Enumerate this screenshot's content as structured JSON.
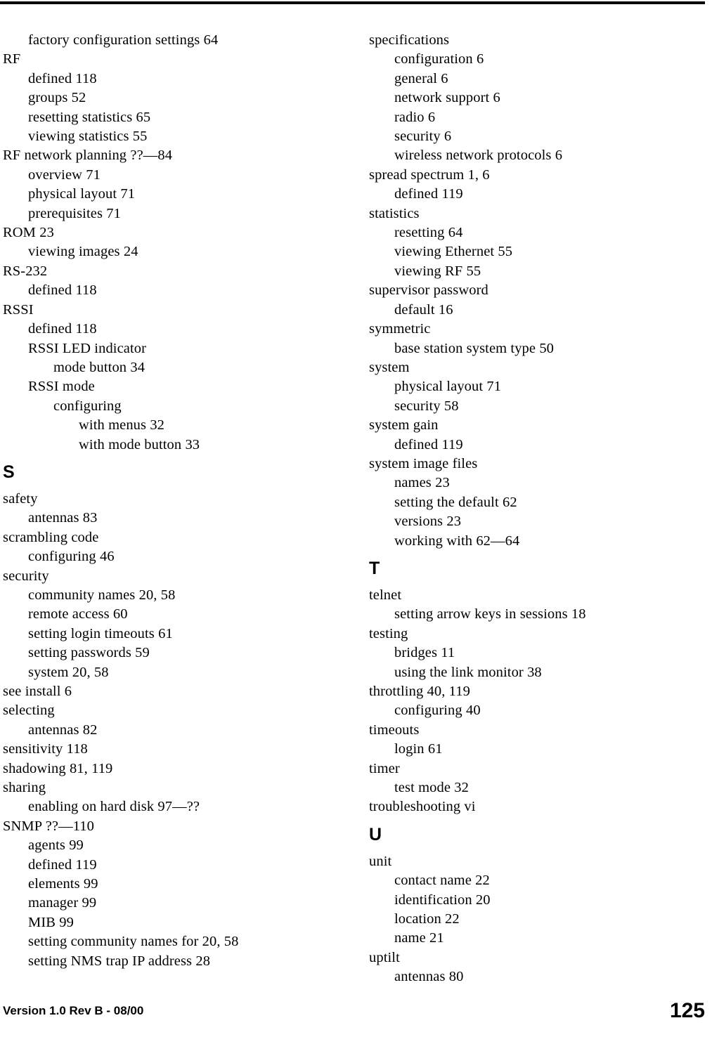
{
  "document": {
    "type": "index",
    "page_number": "125",
    "footer_version": "Version 1.0 Rev B - 08/00"
  },
  "columns": {
    "left": [
      {
        "kind": "entry",
        "level": 1,
        "text": "factory configuration settings 64"
      },
      {
        "kind": "entry",
        "level": 0,
        "text": "RF"
      },
      {
        "kind": "entry",
        "level": 1,
        "text": "defined 118"
      },
      {
        "kind": "entry",
        "level": 1,
        "text": "groups 52"
      },
      {
        "kind": "entry",
        "level": 1,
        "text": "resetting statistics 65"
      },
      {
        "kind": "entry",
        "level": 1,
        "text": "viewing statistics 55"
      },
      {
        "kind": "entry",
        "level": 0,
        "text": "RF network planning ??—84"
      },
      {
        "kind": "entry",
        "level": 1,
        "text": "overview 71"
      },
      {
        "kind": "entry",
        "level": 1,
        "text": "physical layout 71"
      },
      {
        "kind": "entry",
        "level": 1,
        "text": "prerequisites 71"
      },
      {
        "kind": "entry",
        "level": 0,
        "text": "ROM 23"
      },
      {
        "kind": "entry",
        "level": 1,
        "text": "viewing images 24"
      },
      {
        "kind": "entry",
        "level": 0,
        "text": "RS-232"
      },
      {
        "kind": "entry",
        "level": 1,
        "text": "defined 118"
      },
      {
        "kind": "entry",
        "level": 0,
        "text": "RSSI"
      },
      {
        "kind": "entry",
        "level": 1,
        "text": "defined 118"
      },
      {
        "kind": "entry",
        "level": 1,
        "text": "RSSI LED indicator"
      },
      {
        "kind": "entry",
        "level": 2,
        "text": "mode button 34"
      },
      {
        "kind": "entry",
        "level": 1,
        "text": "RSSI mode"
      },
      {
        "kind": "entry",
        "level": 2,
        "text": "configuring"
      },
      {
        "kind": "entry",
        "level": 3,
        "text": "with menus 32"
      },
      {
        "kind": "entry",
        "level": 3,
        "text": "with mode button 33"
      },
      {
        "kind": "heading",
        "level": 0,
        "text": "S"
      },
      {
        "kind": "entry",
        "level": 0,
        "text": "safety"
      },
      {
        "kind": "entry",
        "level": 1,
        "text": "antennas 83"
      },
      {
        "kind": "entry",
        "level": 0,
        "text": "scrambling code"
      },
      {
        "kind": "entry",
        "level": 1,
        "text": "configuring 46"
      },
      {
        "kind": "entry",
        "level": 0,
        "text": "security"
      },
      {
        "kind": "entry",
        "level": 1,
        "text": "community names 20, 58"
      },
      {
        "kind": "entry",
        "level": 1,
        "text": "remote access 60"
      },
      {
        "kind": "entry",
        "level": 1,
        "text": "setting login timeouts 61"
      },
      {
        "kind": "entry",
        "level": 1,
        "text": "setting passwords 59"
      },
      {
        "kind": "entry",
        "level": 1,
        "text": "system 20, 58"
      },
      {
        "kind": "entry",
        "level": 0,
        "text": "see install 6"
      },
      {
        "kind": "entry",
        "level": 0,
        "text": "selecting"
      },
      {
        "kind": "entry",
        "level": 1,
        "text": "antennas 82"
      },
      {
        "kind": "entry",
        "level": 0,
        "text": "sensitivity 118"
      },
      {
        "kind": "entry",
        "level": 0,
        "text": "shadowing 81, 119"
      },
      {
        "kind": "entry",
        "level": 0,
        "text": "sharing"
      },
      {
        "kind": "entry",
        "level": 1,
        "text": "enabling on hard disk 97—??"
      },
      {
        "kind": "entry",
        "level": 0,
        "text": "SNMP ??—110"
      },
      {
        "kind": "entry",
        "level": 1,
        "text": "agents 99"
      },
      {
        "kind": "entry",
        "level": 1,
        "text": "defined 119"
      },
      {
        "kind": "entry",
        "level": 1,
        "text": "elements 99"
      },
      {
        "kind": "entry",
        "level": 1,
        "text": "manager 99"
      },
      {
        "kind": "entry",
        "level": 1,
        "text": "MIB 99"
      },
      {
        "kind": "entry",
        "level": 1,
        "text": "setting community names for 20, 58"
      },
      {
        "kind": "entry",
        "level": 1,
        "text": "setting NMS trap IP address 28"
      }
    ],
    "right": [
      {
        "kind": "entry",
        "level": 0,
        "text": "specifications"
      },
      {
        "kind": "entry",
        "level": 1,
        "text": "configuration 6"
      },
      {
        "kind": "entry",
        "level": 1,
        "text": "general 6"
      },
      {
        "kind": "entry",
        "level": 1,
        "text": "network support 6"
      },
      {
        "kind": "entry",
        "level": 1,
        "text": "radio 6"
      },
      {
        "kind": "entry",
        "level": 1,
        "text": "security 6"
      },
      {
        "kind": "entry",
        "level": 1,
        "text": "wireless network protocols 6"
      },
      {
        "kind": "entry",
        "level": 0,
        "text": "spread spectrum 1, 6"
      },
      {
        "kind": "entry",
        "level": 1,
        "text": "defined 119"
      },
      {
        "kind": "entry",
        "level": 0,
        "text": "statistics"
      },
      {
        "kind": "entry",
        "level": 1,
        "text": "resetting 64"
      },
      {
        "kind": "entry",
        "level": 1,
        "text": "viewing Ethernet 55"
      },
      {
        "kind": "entry",
        "level": 1,
        "text": "viewing RF 55"
      },
      {
        "kind": "entry",
        "level": 0,
        "text": "supervisor password"
      },
      {
        "kind": "entry",
        "level": 1,
        "text": "default 16"
      },
      {
        "kind": "entry",
        "level": 0,
        "text": "symmetric"
      },
      {
        "kind": "entry",
        "level": 1,
        "text": "base station system type 50"
      },
      {
        "kind": "entry",
        "level": 0,
        "text": "system"
      },
      {
        "kind": "entry",
        "level": 1,
        "text": "physical layout 71"
      },
      {
        "kind": "entry",
        "level": 1,
        "text": "security 58"
      },
      {
        "kind": "entry",
        "level": 0,
        "text": "system gain"
      },
      {
        "kind": "entry",
        "level": 1,
        "text": "defined 119"
      },
      {
        "kind": "entry",
        "level": 0,
        "text": "system image files"
      },
      {
        "kind": "entry",
        "level": 1,
        "text": "names 23"
      },
      {
        "kind": "entry",
        "level": 1,
        "text": "setting the default 62"
      },
      {
        "kind": "entry",
        "level": 1,
        "text": "versions 23"
      },
      {
        "kind": "entry",
        "level": 1,
        "text": "working with 62—64"
      },
      {
        "kind": "heading",
        "level": 0,
        "text": "T"
      },
      {
        "kind": "entry",
        "level": 0,
        "text": "telnet"
      },
      {
        "kind": "entry",
        "level": 1,
        "text": "setting arrow keys in sessions 18"
      },
      {
        "kind": "entry",
        "level": 0,
        "text": "testing"
      },
      {
        "kind": "entry",
        "level": 1,
        "text": "bridges 11"
      },
      {
        "kind": "entry",
        "level": 1,
        "text": "using the link monitor 38"
      },
      {
        "kind": "entry",
        "level": 0,
        "text": "throttling 40, 119"
      },
      {
        "kind": "entry",
        "level": 1,
        "text": "configuring 40"
      },
      {
        "kind": "entry",
        "level": 0,
        "text": "timeouts"
      },
      {
        "kind": "entry",
        "level": 1,
        "text": "login 61"
      },
      {
        "kind": "entry",
        "level": 0,
        "text": "timer"
      },
      {
        "kind": "entry",
        "level": 1,
        "text": "test mode 32"
      },
      {
        "kind": "entry",
        "level": 0,
        "text": "troubleshooting vi"
      },
      {
        "kind": "heading",
        "level": 0,
        "text": "U"
      },
      {
        "kind": "entry",
        "level": 0,
        "text": "unit"
      },
      {
        "kind": "entry",
        "level": 1,
        "text": "contact name 22"
      },
      {
        "kind": "entry",
        "level": 1,
        "text": "identification 20"
      },
      {
        "kind": "entry",
        "level": 1,
        "text": "location 22"
      },
      {
        "kind": "entry",
        "level": 1,
        "text": "name 21"
      },
      {
        "kind": "entry",
        "level": 0,
        "text": "uptilt"
      },
      {
        "kind": "entry",
        "level": 1,
        "text": "antennas 80"
      }
    ]
  }
}
